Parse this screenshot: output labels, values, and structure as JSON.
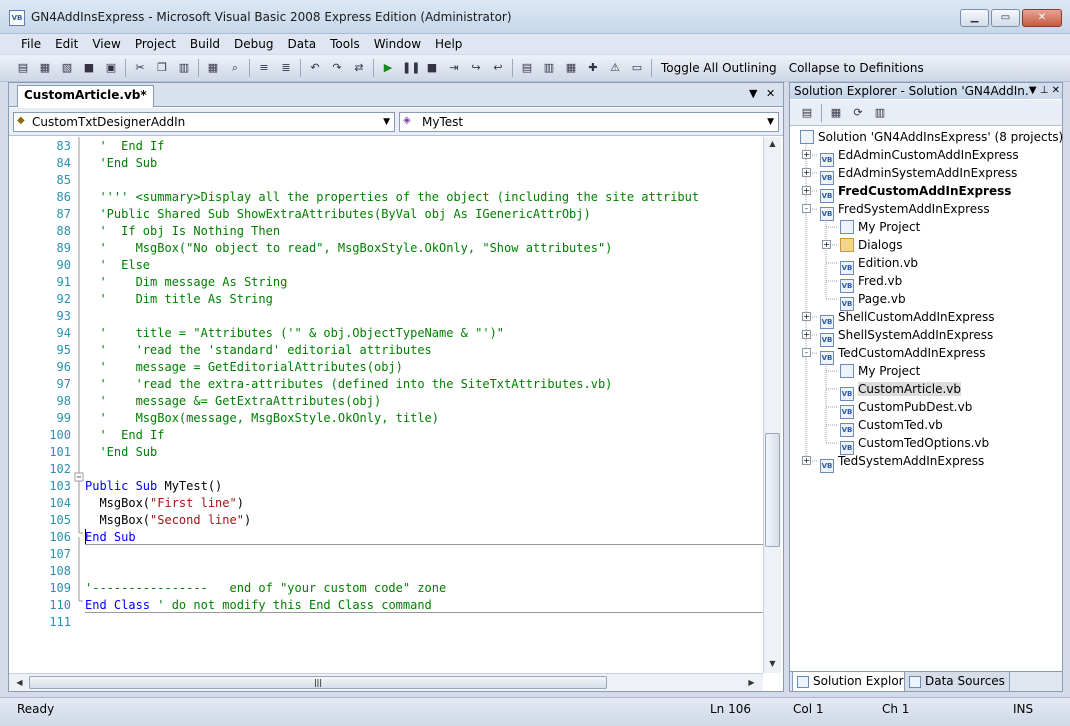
{
  "window": {
    "title": "GN4AddInsExpress - Microsoft Visual Basic 2008 Express Edition (Administrator)",
    "icon_text": "VB"
  },
  "menu": [
    "File",
    "Edit",
    "View",
    "Project",
    "Build",
    "Debug",
    "Data",
    "Tools",
    "Window",
    "Help"
  ],
  "toolbar": {
    "toggle_outlining": "Toggle All Outlining",
    "collapse_definitions": "Collapse to Definitions"
  },
  "editor": {
    "tab_label": "CustomArticle.vb*",
    "class_combo": "CustomTxtDesignerAddIn",
    "method_combo": "MyTest",
    "lines": [
      {
        "n": "83",
        "segs": [
          {
            "t": "  '  End If",
            "c": "cm"
          }
        ]
      },
      {
        "n": "84",
        "segs": [
          {
            "t": "  'End Sub",
            "c": "cm"
          }
        ]
      },
      {
        "n": "85",
        "segs": []
      },
      {
        "n": "86",
        "segs": [
          {
            "t": "  '''' <summary>Display all the properties of the object (including the site attribut",
            "c": "cm"
          }
        ]
      },
      {
        "n": "87",
        "segs": [
          {
            "t": "  'Public Shared Sub ShowExtraAttributes(ByVal obj As IGenericAttrObj)",
            "c": "cm"
          }
        ]
      },
      {
        "n": "88",
        "segs": [
          {
            "t": "  '  If obj Is Nothing Then",
            "c": "cm"
          }
        ]
      },
      {
        "n": "89",
        "segs": [
          {
            "t": "  '    MsgBox(\"No object to read\", MsgBoxStyle.OkOnly, \"Show attributes\")",
            "c": "cm"
          }
        ]
      },
      {
        "n": "90",
        "segs": [
          {
            "t": "  '  Else",
            "c": "cm"
          }
        ]
      },
      {
        "n": "91",
        "segs": [
          {
            "t": "  '    Dim message As String",
            "c": "cm"
          }
        ]
      },
      {
        "n": "92",
        "segs": [
          {
            "t": "  '    Dim title As String",
            "c": "cm"
          }
        ]
      },
      {
        "n": "93",
        "segs": []
      },
      {
        "n": "94",
        "segs": [
          {
            "t": "  '    title = \"Attributes ('\" & obj.ObjectTypeName & \"')\"",
            "c": "cm"
          }
        ]
      },
      {
        "n": "95",
        "segs": [
          {
            "t": "  '    'read the 'standard' editorial attributes",
            "c": "cm"
          }
        ]
      },
      {
        "n": "96",
        "segs": [
          {
            "t": "  '    message = GetEditorialAttributes(obj)",
            "c": "cm"
          }
        ]
      },
      {
        "n": "97",
        "segs": [
          {
            "t": "  '    'read the extra-attributes (defined into the SiteTxtAttributes.vb)",
            "c": "cm"
          }
        ]
      },
      {
        "n": "98",
        "segs": [
          {
            "t": "  '    message &= GetExtraAttributes(obj)",
            "c": "cm"
          }
        ]
      },
      {
        "n": "99",
        "segs": [
          {
            "t": "  '    MsgBox(message, MsgBoxStyle.OkOnly, title)",
            "c": "cm"
          }
        ]
      },
      {
        "n": "100",
        "segs": [
          {
            "t": "  '  End If",
            "c": "cm"
          }
        ]
      },
      {
        "n": "101",
        "segs": [
          {
            "t": "  'End Sub",
            "c": "cm"
          }
        ]
      },
      {
        "n": "102",
        "segs": []
      },
      {
        "n": "103",
        "segs": [
          {
            "t": "Public Sub ",
            "c": "kw"
          },
          {
            "t": "MyTest()",
            "c": ""
          }
        ]
      },
      {
        "n": "104",
        "segs": [
          {
            "t": "  MsgBox(",
            "c": ""
          },
          {
            "t": "\"First line\"",
            "c": "st"
          },
          {
            "t": ")",
            "c": ""
          }
        ]
      },
      {
        "n": "105",
        "segs": [
          {
            "t": "  MsgBox(",
            "c": ""
          },
          {
            "t": "\"Second line\"",
            "c": "st"
          },
          {
            "t": ")",
            "c": ""
          }
        ]
      },
      {
        "n": "106",
        "segs": [
          {
            "t": "End Sub",
            "c": "kw"
          }
        ]
      },
      {
        "n": "107",
        "segs": []
      },
      {
        "n": "108",
        "segs": []
      },
      {
        "n": "109",
        "segs": [
          {
            "t": "'----------------   end of \"your custom code\" zone",
            "c": "cm"
          }
        ]
      },
      {
        "n": "110",
        "segs": [
          {
            "t": "End Class ",
            "c": "kw"
          },
          {
            "t": "' do not modify this End Class command",
            "c": "cm"
          }
        ]
      },
      {
        "n": "111",
        "segs": []
      }
    ]
  },
  "solution_explorer": {
    "title": "Solution Explorer - Solution 'GN4AddIn...",
    "nodes": [
      {
        "label": "Solution 'GN4AddInsExpress' (8 projects)",
        "depth": 0,
        "icon": "solution",
        "exp": "",
        "bold": false
      },
      {
        "label": "EdAdminCustomAddInExpress",
        "depth": 1,
        "icon": "project",
        "exp": "+",
        "bold": false
      },
      {
        "label": "EdAdminSystemAddInExpress",
        "depth": 1,
        "icon": "project",
        "exp": "+",
        "bold": false
      },
      {
        "label": "FredCustomAddInExpress",
        "depth": 1,
        "icon": "project",
        "exp": "+",
        "bold": true
      },
      {
        "label": "FredSystemAddInExpress",
        "depth": 1,
        "icon": "project",
        "exp": "-",
        "bold": false
      },
      {
        "label": "My Project",
        "depth": 2,
        "icon": "myproject",
        "exp": "",
        "bold": false
      },
      {
        "label": "Dialogs",
        "depth": 2,
        "icon": "folder",
        "exp": "+",
        "bold": false
      },
      {
        "label": "Edition.vb",
        "depth": 2,
        "icon": "vb",
        "exp": "",
        "bold": false
      },
      {
        "label": "Fred.vb",
        "depth": 2,
        "icon": "vb",
        "exp": "",
        "bold": false
      },
      {
        "label": "Page.vb",
        "depth": 2,
        "icon": "vb",
        "exp": "",
        "bold": false
      },
      {
        "label": "ShellCustomAddInExpress",
        "depth": 1,
        "icon": "project",
        "exp": "+",
        "bold": false
      },
      {
        "label": "ShellSystemAddInExpress",
        "depth": 1,
        "icon": "project",
        "exp": "+",
        "bold": false
      },
      {
        "label": "TedCustomAddInExpress",
        "depth": 1,
        "icon": "project",
        "exp": "-",
        "bold": false
      },
      {
        "label": "My Project",
        "depth": 2,
        "icon": "myproject",
        "exp": "",
        "bold": false
      },
      {
        "label": "CustomArticle.vb",
        "depth": 2,
        "icon": "vb",
        "exp": "",
        "bold": false,
        "selected": true
      },
      {
        "label": "CustomPubDest.vb",
        "depth": 2,
        "icon": "vb",
        "exp": "",
        "bold": false
      },
      {
        "label": "CustomTed.vb",
        "depth": 2,
        "icon": "vb",
        "exp": "",
        "bold": false
      },
      {
        "label": "CustomTedOptions.vb",
        "depth": 2,
        "icon": "vb",
        "exp": "",
        "bold": false
      },
      {
        "label": "TedSystemAddInExpress",
        "depth": 1,
        "icon": "project",
        "exp": "+",
        "bold": false
      }
    ],
    "tabs": [
      "Solution Explorer",
      "Data Sources"
    ]
  },
  "status": {
    "ready": "Ready",
    "ln": "Ln 106",
    "col": "Col 1",
    "ch": "Ch 1",
    "mode": "INS"
  },
  "colors": {
    "keyword": "#0000ff",
    "comment": "#008000",
    "string": "#a31515",
    "line_number": "#2b91af"
  }
}
